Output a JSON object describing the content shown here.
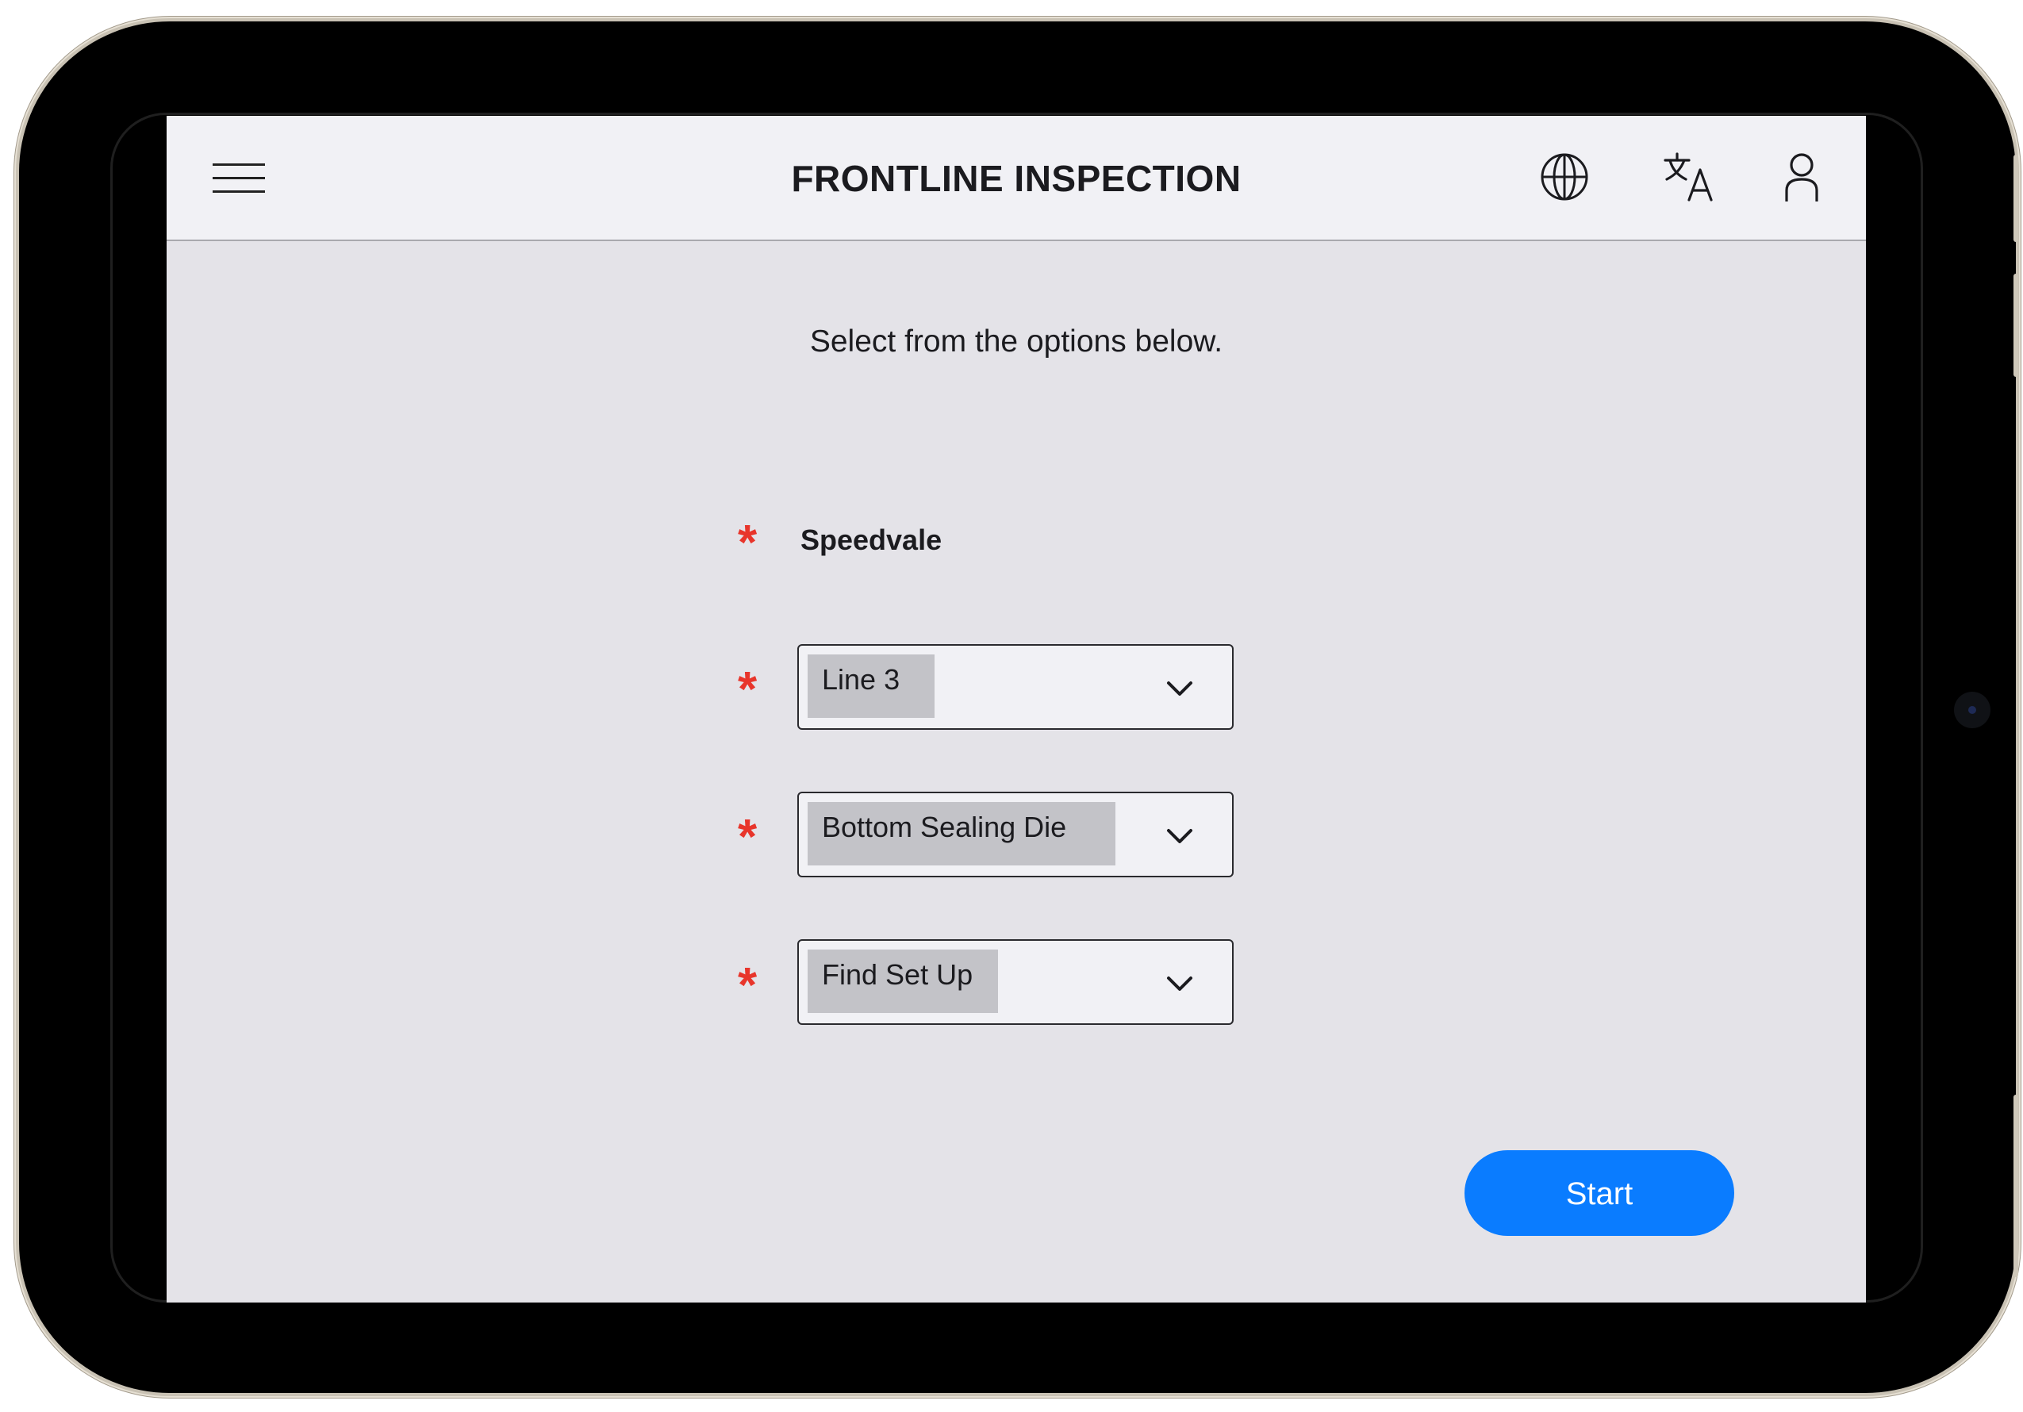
{
  "header": {
    "title": "FRONTLINE INSPECTION",
    "icons": [
      "menu-icon",
      "globe-icon",
      "translate-icon",
      "user-icon"
    ]
  },
  "main": {
    "instruction": "Select from the options below.",
    "required_marker": "*",
    "site": "Speedvale",
    "selects": [
      {
        "value": "Line 3"
      },
      {
        "value": "Bottom Sealing Die"
      },
      {
        "value": "Find Set Up"
      }
    ],
    "start_label": "Start"
  },
  "colors": {
    "accent": "#0a7cff",
    "required": "#e8352b",
    "header_bg": "#f1f1f5",
    "screen_bg": "#e4e3e8"
  }
}
